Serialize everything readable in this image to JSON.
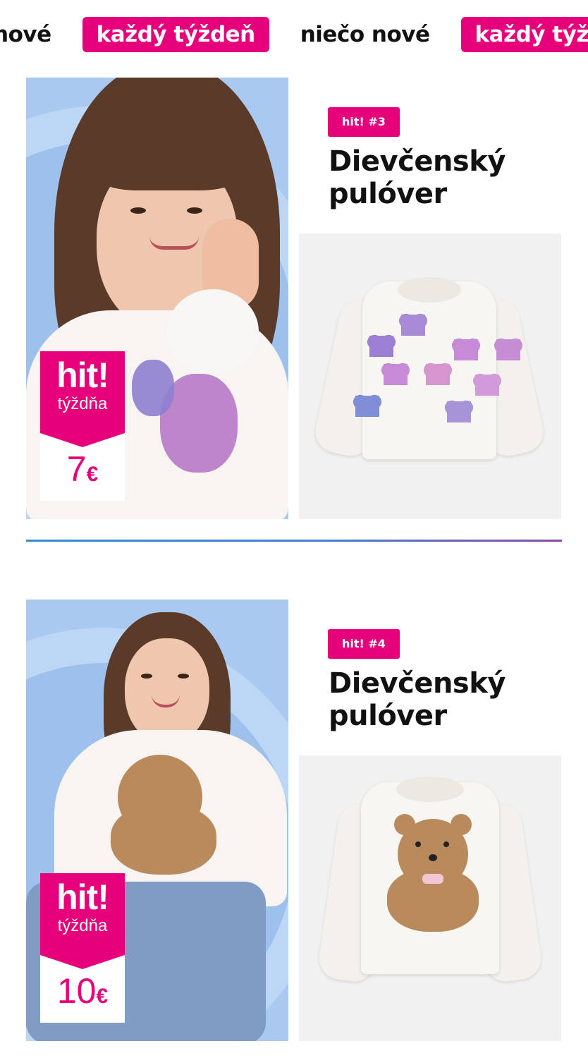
{
  "banner": {
    "items": [
      {
        "text": "nové",
        "style": "plain"
      },
      {
        "text": "každý týždeň",
        "style": "pill"
      },
      {
        "text": "niečo nové",
        "style": "plain"
      },
      {
        "text": "každý týž",
        "style": "pill"
      }
    ]
  },
  "products": [
    {
      "tag": "hit! #3",
      "title": "Dievčenský pulóver",
      "badge": {
        "hit": "hit!",
        "sub": "týždňa",
        "price": "7",
        "currency": "€"
      },
      "accent": "#e6007a"
    },
    {
      "tag": "hit! #4",
      "title": "Dievčenský pulóver",
      "badge": {
        "hit": "hit!",
        "sub": "týždňa",
        "price": "10",
        "currency": "€"
      },
      "accent": "#e6007a"
    }
  ],
  "colors": {
    "brand_pink": "#e6007a",
    "lifestyle_bg": "#a9c9f0",
    "packshot_bg": "#f1f1f1",
    "divider_start": "#2a8fd6",
    "divider_end": "#8a4aa6"
  }
}
